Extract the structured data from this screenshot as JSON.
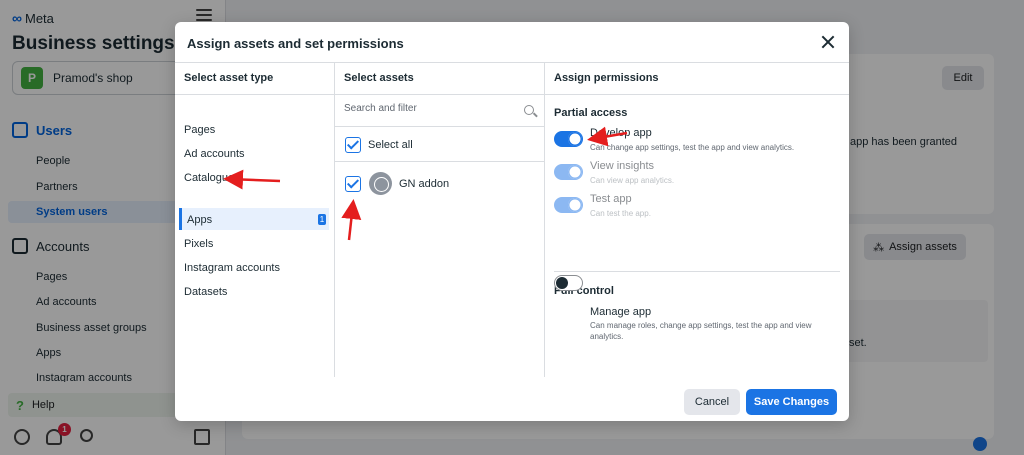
{
  "sidebar": {
    "logo": "Meta",
    "title": "Business settings",
    "shop_initial": "P",
    "shop_name": "Pramod's shop",
    "users_heading": "Users",
    "users_items": [
      "People",
      "Partners",
      "System users"
    ],
    "accounts_heading": "Accounts",
    "accounts_items": [
      "Pages",
      "Ad accounts",
      "Business asset groups",
      "Apps",
      "Instagram accounts"
    ],
    "help": "Help",
    "notification_count": "1"
  },
  "background": {
    "edit_label": "Edit",
    "assign_assets_label": "Assign assets",
    "text_granted": "app has been granted",
    "text_set": "set."
  },
  "modal": {
    "title": "Assign assets and set permissions",
    "col1_heading": "Select asset type",
    "asset_types": [
      "Pages",
      "Ad accounts",
      "Catalogues",
      "Apps",
      "Pixels",
      "Instagram accounts",
      "Datasets"
    ],
    "apps_count": "1",
    "col2_heading": "Select assets",
    "search_placeholder": "Search and filter",
    "select_all": "Select all",
    "asset_name": "GN addon",
    "col3_heading": "Assign permissions",
    "partial_heading": "Partial access",
    "partial_perms": [
      {
        "title": "Develop app",
        "desc": "Can change app settings, test the app and view analytics."
      },
      {
        "title": "View insights",
        "desc": "Can view app analytics."
      },
      {
        "title": "Test app",
        "desc": "Can test the app."
      }
    ],
    "full_heading": "Full control",
    "full_perm": {
      "title": "Manage app",
      "desc": "Can manage roles, change app settings, test the app and view analytics."
    },
    "cancel_label": "Cancel",
    "save_label": "Save Changes"
  },
  "colors": {
    "accent": "#1b74e4",
    "annotation_arrow": "#e41e1e"
  }
}
